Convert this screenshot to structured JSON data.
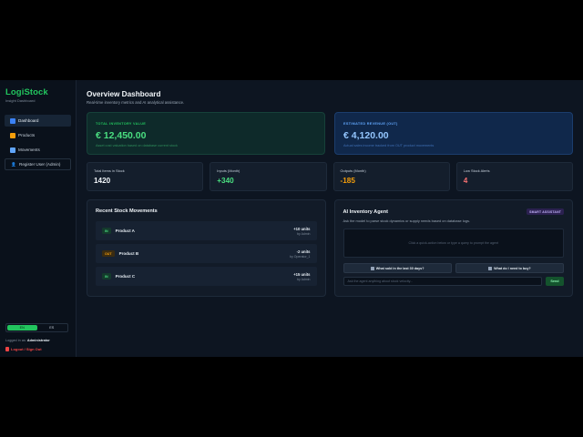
{
  "sidebar": {
    "logo": "LogiStock",
    "subtitle": "Insight Dashboard",
    "items": [
      {
        "label": "Dashboard",
        "icon": "chart-icon"
      },
      {
        "label": "Products",
        "icon": "box-icon"
      },
      {
        "label": "Movements",
        "icon": "swap-icon"
      },
      {
        "label": "Register User (Admin)",
        "icon": "user-icon"
      }
    ],
    "lang": [
      "EN",
      "ES"
    ],
    "logged_prefix": "Logged in as:",
    "logged_user": "Administrator",
    "logout": "Logout / Sign Out"
  },
  "header": {
    "title": "Overview Dashboard",
    "subtitle": "Real-time inventory metrics and AI analytical assistance."
  },
  "kpis": {
    "inventory": {
      "label": "TOTAL INVENTORY VALUE",
      "value": "€ 12,450.00",
      "desc": "Asset cost valuation based on database current stock"
    },
    "revenue": {
      "label": "ESTIMATED REVENUE (OUT)",
      "value": "€ 4,120.00",
      "desc": "Actual sales income tracked from OUT product movements"
    }
  },
  "stats": [
    {
      "label": "Total Items in Stock",
      "value": "1420"
    },
    {
      "label": "Inputs (Month)",
      "value": "+340"
    },
    {
      "label": "Outputs (Month)",
      "value": "-185"
    },
    {
      "label": "Low Stock Alerts",
      "value": "4"
    }
  ],
  "movements": {
    "title": "Recent Stock Movements",
    "rows": [
      {
        "type": "IN",
        "product": "Product A",
        "units": "+10 units",
        "by": "by Admin"
      },
      {
        "type": "OUT",
        "product": "Product B",
        "units": "-2 units",
        "by": "by Operator_1"
      },
      {
        "type": "IN",
        "product": "Product C",
        "units": "+15 units",
        "by": "by Admin"
      }
    ]
  },
  "agent": {
    "title": "AI Inventory Agent",
    "badge": "SMART ASSISTANT",
    "desc": "Ask the model to parse stock dynamics or supply needs based on database logs.",
    "output_placeholder": "Click a quick-action below or type a query to prompt the agent",
    "quick1": "What sold in the last 30 days?",
    "quick2": "What do I need to buy?",
    "input_placeholder": "Ask the agent anything about stock velocity...",
    "send": "Send"
  }
}
